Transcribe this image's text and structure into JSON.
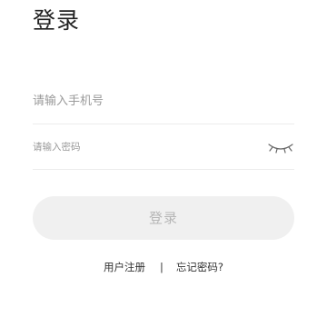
{
  "header": {
    "title": "登录"
  },
  "form": {
    "phone_placeholder": "请输入手机号",
    "password_placeholder": "请输入密码",
    "password_toggle_icon": "eye-closed-icon",
    "submit_label": "登录"
  },
  "links": {
    "register_label": "用户注册",
    "separator": "|",
    "forgot_password_label": "忘记密码?"
  },
  "colors": {
    "title_text": "#222222",
    "placeholder_text": "#9a9a9a",
    "divider_line": "#ececec",
    "button_background": "#f0f0f0",
    "button_text": "#b6b6b6",
    "link_text": "#333333"
  }
}
